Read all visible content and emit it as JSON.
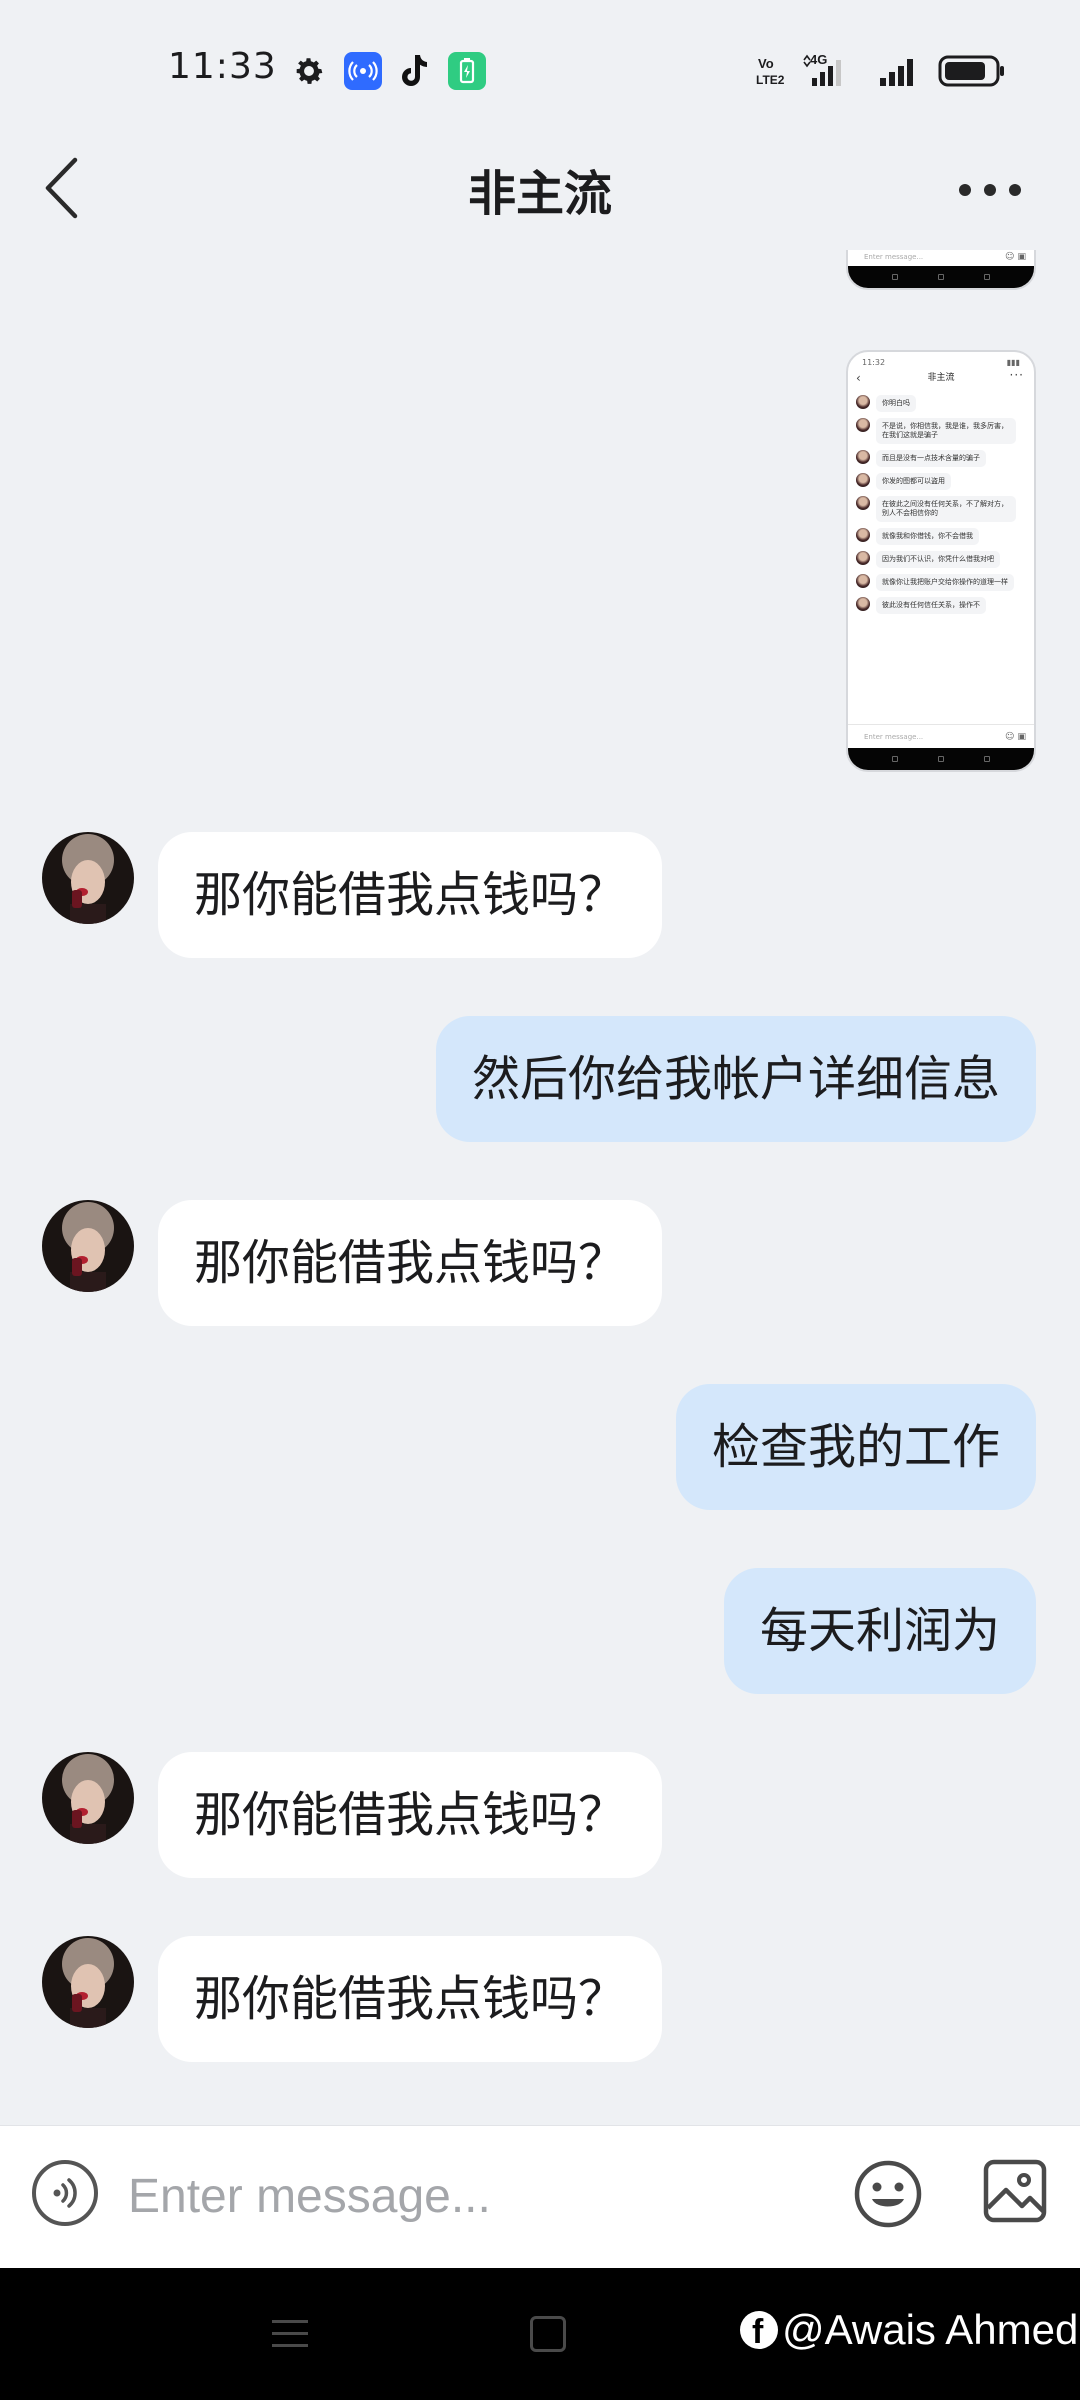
{
  "status_bar": {
    "time": "11:33",
    "icons": [
      "gear-icon",
      "radio-icon",
      "tiktok-icon",
      "battery-app-icon",
      "volte-icon",
      "signal-4g-icon",
      "signal-icon",
      "battery-icon"
    ],
    "network_label": "4G",
    "volte_label": "Vo LTE2"
  },
  "header": {
    "title": "非主流",
    "back_icon": "chevron-left-icon",
    "more_icon": "more-dots-icon"
  },
  "shared_screenshot": {
    "time": "11:32",
    "title": "非主流",
    "input_placeholder": "Enter message...",
    "messages": [
      "你明白吗",
      "不是说，你相信我，我是谁，我多厉害，在我们这就是骗子",
      "而且是没有一点技术含量的骗子",
      "你发的图都可以盗用",
      "在彼此之间没有任何关系，不了解对方，别人不会相信你的",
      "就像我和你借钱，你不会借我",
      "因为我们不认识，你凭什么借我对吧",
      "就像你让我把账户交给你操作的道理一样",
      "彼此没有任何信任关系，操作不"
    ]
  },
  "messages": [
    {
      "side": "in",
      "text": "那你能借我点钱吗？"
    },
    {
      "side": "out",
      "text": "然后你给我帐户详细信息"
    },
    {
      "side": "in",
      "text": "那你能借我点钱吗？"
    },
    {
      "side": "out",
      "text": "检查我的工作"
    },
    {
      "side": "out",
      "text": "每天利润为"
    },
    {
      "side": "in",
      "text": "那你能借我点钱吗？"
    },
    {
      "side": "in",
      "text": "那你能借我点钱吗？"
    }
  ],
  "input_bar": {
    "placeholder": "Enter message...",
    "voice_icon": "voice-icon",
    "emoji_icon": "emoji-icon",
    "image_icon": "image-icon"
  },
  "watermark": {
    "text": "@Awais Ahmed",
    "logo": "facebook-icon"
  },
  "colors": {
    "background": "#eff1f4",
    "incoming_bubble": "#ffffff",
    "outgoing_bubble": "#d4e7fb",
    "nav_bar": "#000000"
  }
}
